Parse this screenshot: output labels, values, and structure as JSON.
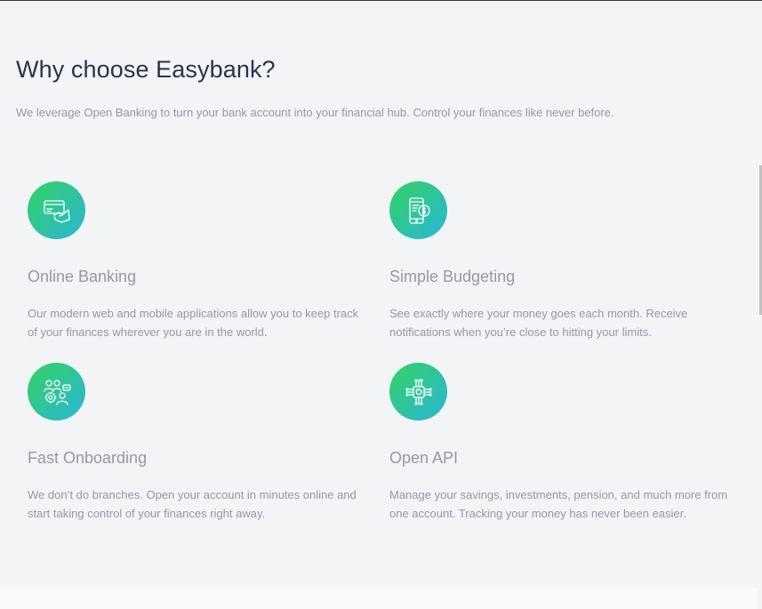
{
  "section": {
    "heading": "Why choose Easybank?",
    "intro": "We leverage Open Banking to turn your bank account into your financial hub. Control your finances like never before."
  },
  "features": [
    {
      "icon": "online-banking-icon",
      "title": "Online Banking",
      "description": "Our modern web and mobile applications allow you to keep track of your finances wherever you are in the world."
    },
    {
      "icon": "simple-budgeting-icon",
      "title": "Simple Budgeting",
      "description": "See exactly where your money goes each month. Receive notifications when you’re close to hitting your limits."
    },
    {
      "icon": "fast-onboarding-icon",
      "title": "Fast Onboarding",
      "description": "We don’t do branches. Open your account in minutes online and start taking control of your finances right away."
    },
    {
      "icon": "open-api-icon",
      "title": "Open API",
      "description": "Manage your savings, investments, pension, and much more from one account. Tracking your money has never been easier."
    }
  ],
  "colors": {
    "background": "#f3f4f6",
    "heading": "#2d314d",
    "body_text": "#9698a6",
    "gradient_start": "#33d35e",
    "gradient_end": "#2ab6d9"
  }
}
